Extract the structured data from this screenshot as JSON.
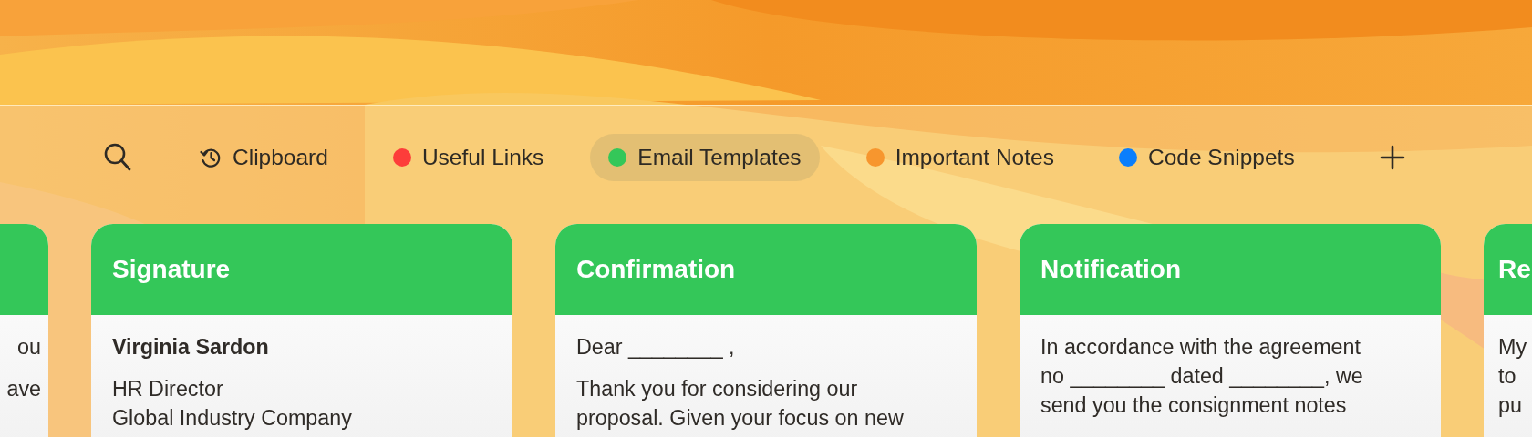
{
  "toolbar": {
    "tabs": [
      {
        "kind": "history",
        "label": "Clipboard",
        "selected": false
      },
      {
        "kind": "collection",
        "label": "Useful Links",
        "color": "#fd3d3a",
        "selected": false
      },
      {
        "kind": "collection",
        "label": "Email Templates",
        "color": "#34c759",
        "selected": true
      },
      {
        "kind": "collection",
        "label": "Important Notes",
        "color": "#f7962e",
        "selected": false
      },
      {
        "kind": "collection",
        "label": "Code Snippets",
        "color": "#0a7efc",
        "selected": false
      }
    ]
  },
  "cards": [
    {
      "kind": "clipped-left",
      "paragraphs": [
        {
          "bold": false,
          "lines": [
            "ou"
          ]
        },
        {
          "bold": false,
          "lines": [
            "ave"
          ]
        }
      ]
    },
    {
      "kind": "full",
      "title": "Signature",
      "paragraphs": [
        {
          "bold": true,
          "lines": [
            "Virginia Sardon"
          ]
        },
        {
          "bold": false,
          "lines": [
            "HR Director",
            "Global Industry Company"
          ]
        }
      ]
    },
    {
      "kind": "full",
      "title": "Confirmation",
      "paragraphs": [
        {
          "bold": false,
          "lines": [
            "Dear ________ ,"
          ]
        },
        {
          "bold": false,
          "lines": [
            "Thank you for considering our",
            "proposal. Given your focus on new"
          ]
        }
      ]
    },
    {
      "kind": "full",
      "title": "Notification",
      "paragraphs": [
        {
          "bold": false,
          "lines": [
            "In accordance with the agreement",
            "no ________ dated ________, we",
            "send you the consignment notes"
          ]
        }
      ]
    },
    {
      "kind": "clipped-right",
      "title": "Re",
      "paragraphs": [
        {
          "bold": false,
          "lines": [
            "My",
            "to",
            "pu"
          ]
        }
      ]
    }
  ]
}
